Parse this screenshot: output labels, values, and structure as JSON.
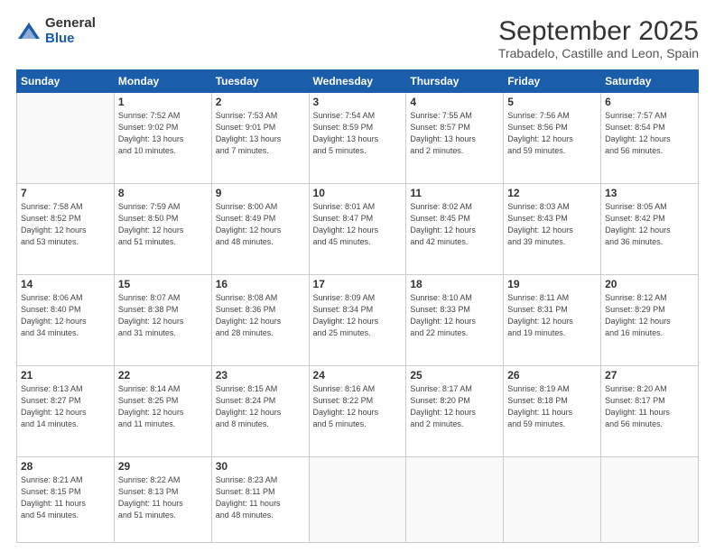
{
  "logo": {
    "general": "General",
    "blue": "Blue"
  },
  "title": "September 2025",
  "subtitle": "Trabadelo, Castille and Leon, Spain",
  "headers": [
    "Sunday",
    "Monday",
    "Tuesday",
    "Wednesday",
    "Thursday",
    "Friday",
    "Saturday"
  ],
  "weeks": [
    [
      {
        "day": "",
        "info": ""
      },
      {
        "day": "1",
        "info": "Sunrise: 7:52 AM\nSunset: 9:02 PM\nDaylight: 13 hours\nand 10 minutes."
      },
      {
        "day": "2",
        "info": "Sunrise: 7:53 AM\nSunset: 9:01 PM\nDaylight: 13 hours\nand 7 minutes."
      },
      {
        "day": "3",
        "info": "Sunrise: 7:54 AM\nSunset: 8:59 PM\nDaylight: 13 hours\nand 5 minutes."
      },
      {
        "day": "4",
        "info": "Sunrise: 7:55 AM\nSunset: 8:57 PM\nDaylight: 13 hours\nand 2 minutes."
      },
      {
        "day": "5",
        "info": "Sunrise: 7:56 AM\nSunset: 8:56 PM\nDaylight: 12 hours\nand 59 minutes."
      },
      {
        "day": "6",
        "info": "Sunrise: 7:57 AM\nSunset: 8:54 PM\nDaylight: 12 hours\nand 56 minutes."
      }
    ],
    [
      {
        "day": "7",
        "info": "Sunrise: 7:58 AM\nSunset: 8:52 PM\nDaylight: 12 hours\nand 53 minutes."
      },
      {
        "day": "8",
        "info": "Sunrise: 7:59 AM\nSunset: 8:50 PM\nDaylight: 12 hours\nand 51 minutes."
      },
      {
        "day": "9",
        "info": "Sunrise: 8:00 AM\nSunset: 8:49 PM\nDaylight: 12 hours\nand 48 minutes."
      },
      {
        "day": "10",
        "info": "Sunrise: 8:01 AM\nSunset: 8:47 PM\nDaylight: 12 hours\nand 45 minutes."
      },
      {
        "day": "11",
        "info": "Sunrise: 8:02 AM\nSunset: 8:45 PM\nDaylight: 12 hours\nand 42 minutes."
      },
      {
        "day": "12",
        "info": "Sunrise: 8:03 AM\nSunset: 8:43 PM\nDaylight: 12 hours\nand 39 minutes."
      },
      {
        "day": "13",
        "info": "Sunrise: 8:05 AM\nSunset: 8:42 PM\nDaylight: 12 hours\nand 36 minutes."
      }
    ],
    [
      {
        "day": "14",
        "info": "Sunrise: 8:06 AM\nSunset: 8:40 PM\nDaylight: 12 hours\nand 34 minutes."
      },
      {
        "day": "15",
        "info": "Sunrise: 8:07 AM\nSunset: 8:38 PM\nDaylight: 12 hours\nand 31 minutes."
      },
      {
        "day": "16",
        "info": "Sunrise: 8:08 AM\nSunset: 8:36 PM\nDaylight: 12 hours\nand 28 minutes."
      },
      {
        "day": "17",
        "info": "Sunrise: 8:09 AM\nSunset: 8:34 PM\nDaylight: 12 hours\nand 25 minutes."
      },
      {
        "day": "18",
        "info": "Sunrise: 8:10 AM\nSunset: 8:33 PM\nDaylight: 12 hours\nand 22 minutes."
      },
      {
        "day": "19",
        "info": "Sunrise: 8:11 AM\nSunset: 8:31 PM\nDaylight: 12 hours\nand 19 minutes."
      },
      {
        "day": "20",
        "info": "Sunrise: 8:12 AM\nSunset: 8:29 PM\nDaylight: 12 hours\nand 16 minutes."
      }
    ],
    [
      {
        "day": "21",
        "info": "Sunrise: 8:13 AM\nSunset: 8:27 PM\nDaylight: 12 hours\nand 14 minutes."
      },
      {
        "day": "22",
        "info": "Sunrise: 8:14 AM\nSunset: 8:25 PM\nDaylight: 12 hours\nand 11 minutes."
      },
      {
        "day": "23",
        "info": "Sunrise: 8:15 AM\nSunset: 8:24 PM\nDaylight: 12 hours\nand 8 minutes."
      },
      {
        "day": "24",
        "info": "Sunrise: 8:16 AM\nSunset: 8:22 PM\nDaylight: 12 hours\nand 5 minutes."
      },
      {
        "day": "25",
        "info": "Sunrise: 8:17 AM\nSunset: 8:20 PM\nDaylight: 12 hours\nand 2 minutes."
      },
      {
        "day": "26",
        "info": "Sunrise: 8:19 AM\nSunset: 8:18 PM\nDaylight: 11 hours\nand 59 minutes."
      },
      {
        "day": "27",
        "info": "Sunrise: 8:20 AM\nSunset: 8:17 PM\nDaylight: 11 hours\nand 56 minutes."
      }
    ],
    [
      {
        "day": "28",
        "info": "Sunrise: 8:21 AM\nSunset: 8:15 PM\nDaylight: 11 hours\nand 54 minutes."
      },
      {
        "day": "29",
        "info": "Sunrise: 8:22 AM\nSunset: 8:13 PM\nDaylight: 11 hours\nand 51 minutes."
      },
      {
        "day": "30",
        "info": "Sunrise: 8:23 AM\nSunset: 8:11 PM\nDaylight: 11 hours\nand 48 minutes."
      },
      {
        "day": "",
        "info": ""
      },
      {
        "day": "",
        "info": ""
      },
      {
        "day": "",
        "info": ""
      },
      {
        "day": "",
        "info": ""
      }
    ]
  ]
}
